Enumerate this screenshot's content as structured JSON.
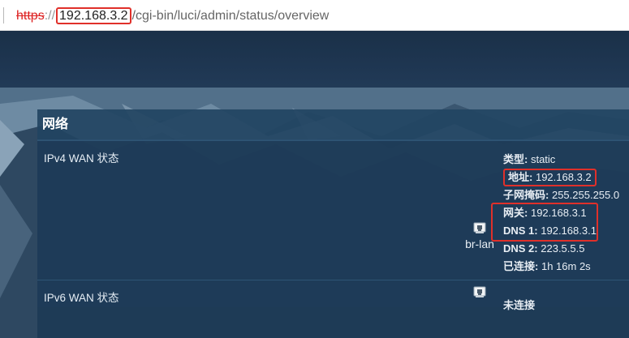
{
  "browser": {
    "url_scheme": "https",
    "url_separator": "://",
    "url_host": "192.168.3.2",
    "url_path": "/cgi-bin/luci/admin/status/overview"
  },
  "panel": {
    "title": "网络"
  },
  "ipv4": {
    "label": "IPv4 WAN 状态",
    "interface": "br-lan",
    "type_label": "类型:",
    "type_value": "static",
    "address_label": "地址:",
    "address_value": "192.168.3.2",
    "netmask_label": "子网掩码:",
    "netmask_value": "255.255.255.0",
    "gateway_label": "网关:",
    "gateway_value": "192.168.3.1",
    "dns1_label": "DNS 1:",
    "dns1_value": "192.168.3.1",
    "dns2_label": "DNS 2:",
    "dns2_value": "223.5.5.5",
    "connected_label": "已连接:",
    "connected_value": "1h 16m 2s"
  },
  "ipv6": {
    "label": "IPv6 WAN 状态",
    "status": "未连接"
  },
  "icons": {
    "network_port": "network-port-icon"
  },
  "colors": {
    "highlight": "#e0302a",
    "panel_bg": "#1d3954"
  }
}
